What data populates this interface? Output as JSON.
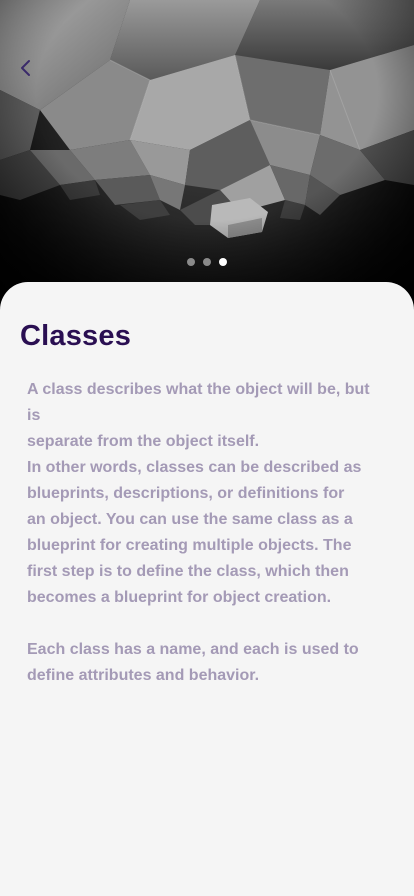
{
  "header": {
    "back_icon": "chevron-left-icon"
  },
  "carousel": {
    "slide_count": 3,
    "active_index": 2
  },
  "content": {
    "title": "Classes",
    "lines": [
      "A class describes what the object will be, but is",
      "separate from the object itself.",
      "In other words, classes can be described as",
      "blueprints, descriptions, or definitions for",
      "an object. You can use the same class as a",
      "blueprint for creating multiple objects. The",
      "first step is to define the class, which then",
      "becomes a blueprint for object creation."
    ],
    "lines2": [
      "Each class has a name, and each is used to",
      "define attributes and behavior."
    ]
  },
  "colors": {
    "title": "#2a0f52",
    "body": "#a49ab6",
    "back_icon": "#3a2a6a",
    "dot_active": "#ffffff",
    "dot_inactive": "#8a8a8a",
    "sheet": "#f5f5f5"
  }
}
